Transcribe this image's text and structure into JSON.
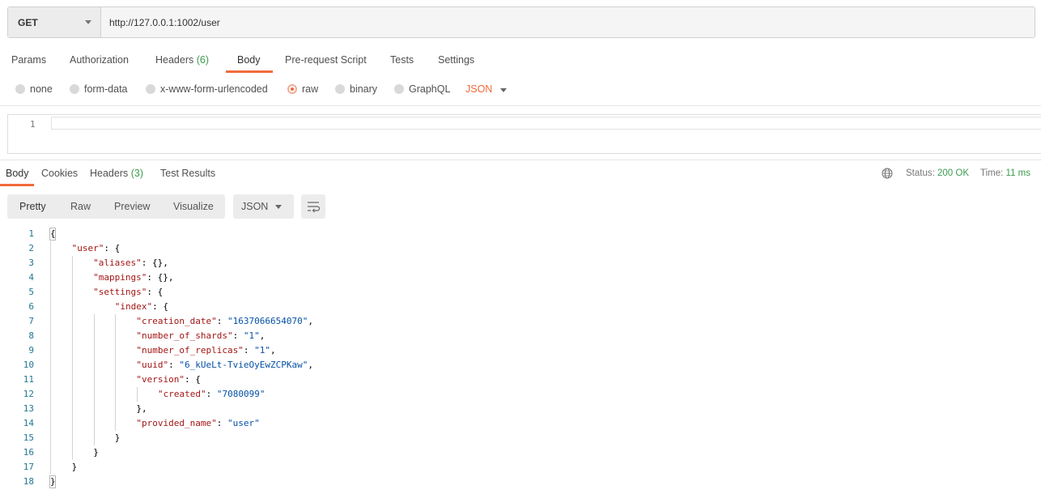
{
  "request": {
    "method": "GET",
    "url": "http://127.0.0.1:1002/user"
  },
  "request_tabs": [
    {
      "label": "Params",
      "count": ""
    },
    {
      "label": "Authorization",
      "count": ""
    },
    {
      "label": "Headers",
      "count": "(6)"
    },
    {
      "label": "Body",
      "count": "",
      "active": true
    },
    {
      "label": "Pre-request Script",
      "count": ""
    },
    {
      "label": "Tests",
      "count": ""
    },
    {
      "label": "Settings",
      "count": ""
    }
  ],
  "body_types": [
    {
      "label": "none",
      "selected": false
    },
    {
      "label": "form-data",
      "selected": false
    },
    {
      "label": "x-www-form-urlencoded",
      "selected": false
    },
    {
      "label": "raw",
      "selected": true
    },
    {
      "label": "binary",
      "selected": false
    },
    {
      "label": "GraphQL",
      "selected": false
    }
  ],
  "body_format": "JSON",
  "request_editor": {
    "line_number": "1"
  },
  "response_tabs": [
    {
      "label": "Body",
      "count": "",
      "active": true
    },
    {
      "label": "Cookies",
      "count": ""
    },
    {
      "label": "Headers",
      "count": "(3)"
    },
    {
      "label": "Test Results",
      "count": ""
    }
  ],
  "response_meta": {
    "status_label": "Status:",
    "status_value": "200 OK",
    "time_label": "Time:",
    "time_value": "11 ms"
  },
  "view_modes": [
    "Pretty",
    "Raw",
    "Preview",
    "Visualize"
  ],
  "response_format": "JSON",
  "colors": {
    "accent": "#f26b3a",
    "success": "#3c9b4e",
    "json_key": "#a31515",
    "json_string": "#0451a5",
    "line_number": "#237893"
  },
  "icons": {
    "globe": "globe-icon",
    "wrap": "wrap-lines-icon"
  },
  "response_lines": [
    {
      "n": "1",
      "indent": 0,
      "text": "{"
    },
    {
      "n": "2",
      "indent": 1,
      "key": "\"user\"",
      "text": ": {"
    },
    {
      "n": "3",
      "indent": 2,
      "key": "\"aliases\"",
      "text": ": {},"
    },
    {
      "n": "4",
      "indent": 2,
      "key": "\"mappings\"",
      "text": ": {},"
    },
    {
      "n": "5",
      "indent": 2,
      "key": "\"settings\"",
      "text": ": {"
    },
    {
      "n": "6",
      "indent": 3,
      "key": "\"index\"",
      "text": ": {"
    },
    {
      "n": "7",
      "indent": 4,
      "key": "\"creation_date\"",
      "sep": ": ",
      "val": "\"1637066654070\"",
      "text": ","
    },
    {
      "n": "8",
      "indent": 4,
      "key": "\"number_of_shards\"",
      "sep": ": ",
      "val": "\"1\"",
      "text": ","
    },
    {
      "n": "9",
      "indent": 4,
      "key": "\"number_of_replicas\"",
      "sep": ": ",
      "val": "\"1\"",
      "text": ","
    },
    {
      "n": "10",
      "indent": 4,
      "key": "\"uuid\"",
      "sep": ": ",
      "val": "\"6_kUeLt-TvieOyEwZCPKaw\"",
      "text": ","
    },
    {
      "n": "11",
      "indent": 4,
      "key": "\"version\"",
      "text": ": {"
    },
    {
      "n": "12",
      "indent": 5,
      "key": "\"created\"",
      "sep": ": ",
      "val": "\"7080099\"",
      "text": ""
    },
    {
      "n": "13",
      "indent": 4,
      "text": "},"
    },
    {
      "n": "14",
      "indent": 4,
      "key": "\"provided_name\"",
      "sep": ": ",
      "val": "\"user\"",
      "text": ""
    },
    {
      "n": "15",
      "indent": 3,
      "text": "}"
    },
    {
      "n": "16",
      "indent": 2,
      "text": "}"
    },
    {
      "n": "17",
      "indent": 1,
      "text": "}"
    },
    {
      "n": "18",
      "indent": 0,
      "text": "}"
    }
  ]
}
